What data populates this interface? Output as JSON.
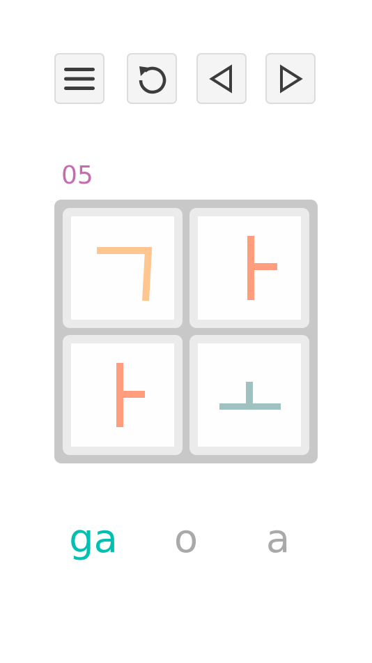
{
  "toolbar": {
    "menu_icon": "hamburger-menu-icon",
    "restart_icon": "restart-icon",
    "previous_icon": "triangle-left-icon",
    "next_icon": "triangle-right-icon"
  },
  "level": {
    "number": "05",
    "color": "#c66bb0"
  },
  "board": {
    "tiles": [
      {
        "jamo": "ㄱ",
        "color": "#ffc690"
      },
      {
        "jamo": "ㅏ",
        "color": "#ff9d7d"
      },
      {
        "jamo": "ㅏ",
        "color": "#ff9d7d"
      },
      {
        "jamo": "ㅗ",
        "color": "#9fc2c0"
      }
    ]
  },
  "answers": [
    {
      "text": "ga",
      "state": "solved",
      "color": "#00bfb3"
    },
    {
      "text": "o",
      "state": "pending",
      "color": "#a9a9a9"
    },
    {
      "text": "a",
      "state": "pending",
      "color": "#a9a9a9"
    }
  ]
}
